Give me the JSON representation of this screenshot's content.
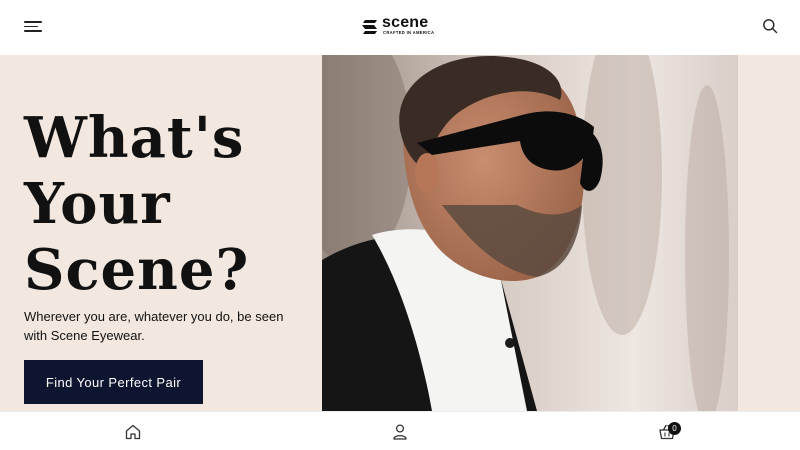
{
  "header": {
    "brand_name": "scene",
    "brand_tagline": "CRAFTED IN AMERICA",
    "icons": {
      "menu": "hamburger-menu-icon",
      "logo": "scene-logo-mark-icon",
      "search": "search-icon"
    }
  },
  "hero": {
    "headline": [
      "What's",
      "Your",
      "Scene?"
    ],
    "subtext": "Wherever you are, whatever you do, be seen with Scene Eyewear.",
    "cta_label": "Find Your Perfect Pair",
    "image": "man-wearing-sunglasses-photo"
  },
  "bottom_nav": {
    "icons": [
      "home-icon",
      "account-icon",
      "cart-icon"
    ],
    "cart_count": "0"
  },
  "colors": {
    "hero_background": "#f3e8df",
    "cta_background": "#0d1530",
    "cta_text": "#ffffff",
    "text": "#111111"
  }
}
